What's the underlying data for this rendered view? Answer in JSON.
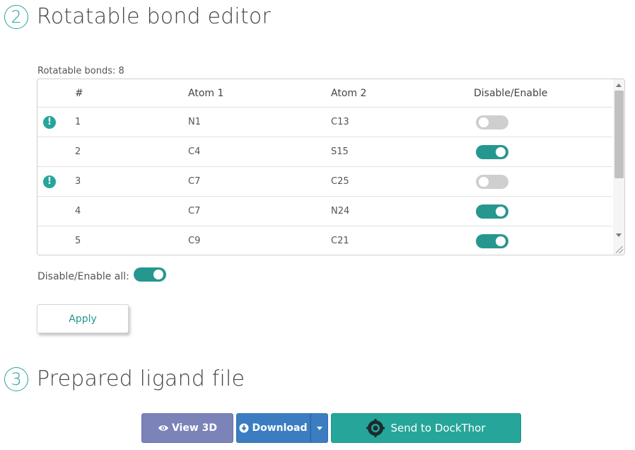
{
  "section2": {
    "step": "2",
    "title": "Rotatable bond editor"
  },
  "bond_count_label": "Rotatable bonds: 8",
  "table": {
    "headers": {
      "num": "#",
      "atom1": "Atom 1",
      "atom2": "Atom 2",
      "toggle": "Disable/Enable"
    },
    "rows": [
      {
        "warning": true,
        "num": "1",
        "atom1": "N1",
        "atom2": "C13",
        "enabled": false
      },
      {
        "warning": false,
        "num": "2",
        "atom1": "C4",
        "atom2": "S15",
        "enabled": true
      },
      {
        "warning": true,
        "num": "3",
        "atom1": "C7",
        "atom2": "C25",
        "enabled": false
      },
      {
        "warning": false,
        "num": "4",
        "atom1": "C7",
        "atom2": "N24",
        "enabled": true
      },
      {
        "warning": false,
        "num": "5",
        "atom1": "C9",
        "atom2": "C21",
        "enabled": true
      }
    ]
  },
  "toggle_all": {
    "label": "Disable/Enable all:",
    "enabled": true
  },
  "apply_label": "Apply",
  "section3": {
    "step": "3",
    "title": "Prepared ligand file"
  },
  "buttons": {
    "view3d": "View 3D",
    "download": "Download",
    "dockthor": "Send to DockThor"
  },
  "colors": {
    "accent": "#26a69a",
    "toggle_on": "#26978f",
    "view3d": "#7b83b8",
    "download": "#3c7dc2"
  },
  "icons": {
    "warning": "exclamation-circle-icon",
    "view3d": "eye-icon",
    "download": "download-circle-icon",
    "dockthor": "dockthor-logo-icon"
  }
}
